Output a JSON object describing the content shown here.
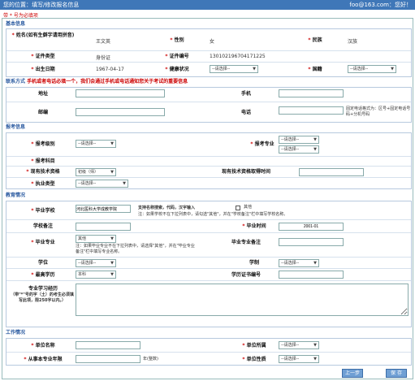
{
  "header": {
    "title": "您的位置：填写/修改报名信息",
    "user": "foo@163.com：您好！"
  },
  "notice": "带 * 号为必填项",
  "basic": {
    "title": "基本信息",
    "name_label": "姓名(如有生僻字请用拼音)",
    "name_value": "王文英",
    "gender_label": "性别",
    "gender_value": "女",
    "ethnic_label": "民族",
    "ethnic_value": "汉族",
    "idtype_label": "证件类型",
    "idtype_value": "身份证",
    "idno_label": "证件编号",
    "idno_value": "130102196704171225",
    "birth_label": "出生日期",
    "birth_value": "1967-04-17",
    "health_label": "健康状况",
    "health_value": "--请选择--",
    "nation_label": "国籍",
    "nation_value": "--请选择--"
  },
  "contact": {
    "title": "联系方式",
    "warning": "手机或者电话必填一个，我们会通过手机或电话通知您关于考试的重要信息",
    "address_label": "地址",
    "mobile_label": "手机",
    "postcode_label": "邮编",
    "phone_label": "电话",
    "phone_hint": "固定电话格式为：区号+固定电话号码+分机号码"
  },
  "exam": {
    "title": "报考信息",
    "category_label": "报考级别",
    "category_value": "--请选择--",
    "major_label": "报考专业",
    "major_value1": "--请选择--",
    "major_value2": "--请选择--",
    "subject_label": "报考科目",
    "qual_label": "现有技术资格",
    "qual_value": "初级（师）",
    "qual_time_label": "现有技术资格取得时间",
    "practice_label": "执业类型",
    "practice_value": "--请选择--"
  },
  "edu": {
    "title": "教育情况",
    "school_label": "毕业学校",
    "school_value": "河北医科大学成教学院",
    "school_hint": "支持名称搜索，代码，汉字输入",
    "other_label": "其他",
    "school_note": "注：如果学校不在下拉列表中，请勾选\"其他\"，并在\"学校备注\"栏中填写学校名称。",
    "school_remark_label": "学校备注",
    "grad_time_label": "毕业时间",
    "grad_time_value": "2001-01",
    "major_label": "毕业专业",
    "major_value": "其他",
    "major_note": "注：如果毕业专业不在下拉列表中，请选择\"其他\"，并在\"毕业专业备注\"栏中填写专业名称。",
    "major_remark_label": "毕业专业备注",
    "degree_label": "学位",
    "degree_value": "--请选择--",
    "system_label": "学制",
    "system_value": "--请选择--",
    "highest_label": "最高学历",
    "highest_value": "本科",
    "cert_label": "学历证书编号",
    "exp_label": "专业学习经历",
    "exp_note": "（带\"*\"号的字（土）的考生必须填写此项，限250字以内。）"
  },
  "work": {
    "title": "工作情况",
    "unit_label": "单位名称",
    "region_label": "单位所属",
    "region_value": "--请选择--",
    "years_label": "从事本专业年限",
    "years_unit": "年(整数)",
    "nature_label": "单位性质",
    "nature_value": "--请选择--"
  },
  "buttons": {
    "prev": "上一步",
    "save": "保 存"
  }
}
